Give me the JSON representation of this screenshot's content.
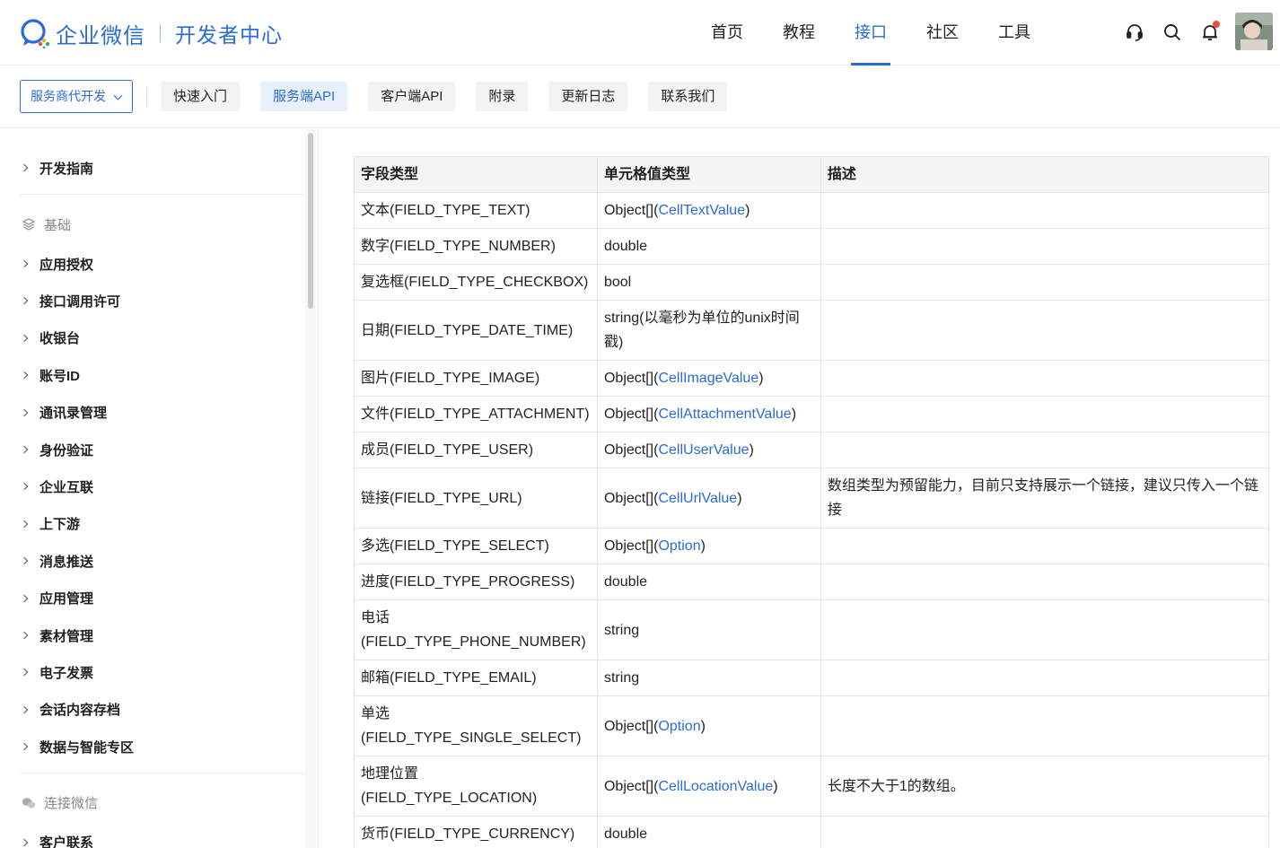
{
  "header": {
    "brand": "企业微信",
    "subtitle": "开发者中心",
    "nav": [
      {
        "label": "首页",
        "active": false
      },
      {
        "label": "教程",
        "active": false
      },
      {
        "label": "接口",
        "active": true
      },
      {
        "label": "社区",
        "active": false
      },
      {
        "label": "工具",
        "active": false
      }
    ],
    "icons": [
      "headset-icon",
      "search-icon",
      "bell-icon"
    ]
  },
  "subnav": {
    "dropdown": "服务商代开发",
    "tabs": [
      {
        "label": "快速入门",
        "active": false
      },
      {
        "label": "服务端API",
        "active": true
      },
      {
        "label": "客户端API",
        "active": false
      },
      {
        "label": "附录",
        "active": false
      },
      {
        "label": "更新日志",
        "active": false
      },
      {
        "label": "联系我们",
        "active": false
      }
    ]
  },
  "sidebar": {
    "top_item": "开发指南",
    "groups": [
      {
        "title": "基础",
        "items": [
          "应用授权",
          "接口调用许可",
          "收银台",
          "账号ID",
          "通讯录管理",
          "身份验证",
          "企业互联",
          "上下游",
          "消息推送",
          "应用管理",
          "素材管理",
          "电子发票",
          "会话内容存档",
          "数据与智能专区"
        ]
      },
      {
        "title": "连接微信",
        "items": [
          "客户联系"
        ]
      }
    ]
  },
  "table": {
    "headers": [
      "字段类型",
      "单元格值类型",
      "描述"
    ],
    "rows": [
      {
        "field": "文本(FIELD_TYPE_TEXT)",
        "type_prefix": "Object[](",
        "type_link": "CellTextValue",
        "type_suffix": ")",
        "desc": ""
      },
      {
        "field": "数字(FIELD_TYPE_NUMBER)",
        "type_prefix": "double",
        "type_link": "",
        "type_suffix": "",
        "desc": ""
      },
      {
        "field": "复选框(FIELD_TYPE_CHECKBOX)",
        "type_prefix": "bool",
        "type_link": "",
        "type_suffix": "",
        "desc": ""
      },
      {
        "field": "日期(FIELD_TYPE_DATE_TIME)",
        "type_prefix": "string(以毫秒为单位的unix时间戳)",
        "type_link": "",
        "type_suffix": "",
        "desc": ""
      },
      {
        "field": "图片(FIELD_TYPE_IMAGE)",
        "type_prefix": "Object[](",
        "type_link": "CellImageValue",
        "type_suffix": ")",
        "desc": ""
      },
      {
        "field": "文件(FIELD_TYPE_ATTACHMENT)",
        "type_prefix": "Object[](",
        "type_link": "CellAttachmentValue",
        "type_suffix": ")",
        "desc": ""
      },
      {
        "field": "成员(FIELD_TYPE_USER)",
        "type_prefix": "Object[](",
        "type_link": "CellUserValue",
        "type_suffix": ")",
        "desc": ""
      },
      {
        "field": "链接(FIELD_TYPE_URL)",
        "type_prefix": "Object[](",
        "type_link": "CellUrlValue",
        "type_suffix": ")",
        "desc": "数组类型为预留能力，目前只支持展示一个链接，建议只传入一个链接"
      },
      {
        "field": "多选(FIELD_TYPE_SELECT)",
        "type_prefix": "Object[](",
        "type_link": "Option",
        "type_suffix": ")",
        "desc": ""
      },
      {
        "field": "进度(FIELD_TYPE_PROGRESS)",
        "type_prefix": "double",
        "type_link": "",
        "type_suffix": "",
        "desc": ""
      },
      {
        "field": "电话(FIELD_TYPE_PHONE_NUMBER)",
        "type_prefix": "string",
        "type_link": "",
        "type_suffix": "",
        "desc": ""
      },
      {
        "field": "邮箱(FIELD_TYPE_EMAIL)",
        "type_prefix": "string",
        "type_link": "",
        "type_suffix": "",
        "desc": ""
      },
      {
        "field": "单选(FIELD_TYPE_SINGLE_SELECT)",
        "type_prefix": "Object[](",
        "type_link": "Option",
        "type_suffix": ")",
        "desc": ""
      },
      {
        "field": "地理位置(FIELD_TYPE_LOCATION)",
        "type_prefix": "Object[](",
        "type_link": "CellLocationValue",
        "type_suffix": ")",
        "desc": "长度不大于1的数组。"
      },
      {
        "field": "货币(FIELD_TYPE_CURRENCY)",
        "type_prefix": "double",
        "type_link": "",
        "type_suffix": "",
        "desc": ""
      }
    ]
  },
  "colors": {
    "accent": "#2b6bd8",
    "notification": "#f04b3c"
  }
}
